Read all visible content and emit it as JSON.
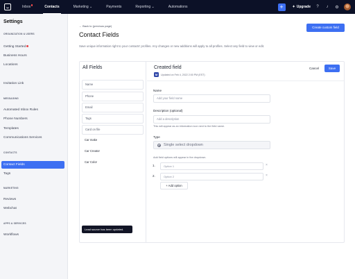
{
  "topnav": {
    "tabs": [
      {
        "label": "Inbox",
        "badge": true
      },
      {
        "label": "Contacts",
        "active": true
      },
      {
        "label": "Marketing ⌄"
      },
      {
        "label": "Payments"
      },
      {
        "label": "Reporting ⌄"
      },
      {
        "label": "Automations"
      }
    ],
    "add_label": "+",
    "upgrade_label": "Upgrade",
    "icons": [
      "upgrade-icon",
      "help-icon",
      "notification-icon",
      "settings-icon"
    ]
  },
  "sidebar": {
    "title": "Settings",
    "sections": {
      "org": "ORGANIZATION & USERS",
      "messaging": "MESSAGING",
      "contacts": "CONTACTS",
      "marketing": "MARKETING",
      "apps": "APPS & SERVICES"
    },
    "items": {
      "getting_started": "Getting Started",
      "business_hours": "Business Hours",
      "locations": "Locations",
      "invitation_link": "Invitation Link",
      "automated_inbox_rules": "Automated Inbox Rules",
      "phone_numbers": "Phone Numbers",
      "templates": "Templates",
      "communications_services": "Communications Services",
      "contact_fields": "Contact Fields",
      "tags": "Tags",
      "reviews": "Reviews",
      "webchat": "Webchat",
      "workflows": "Workflows"
    }
  },
  "main": {
    "back_link": "← Back to (previous page)",
    "title": "Contact Fields",
    "description": "Save unique information right to your contacts' profiles. Any changes or new additions will apply to all profiles. Select any field to view or edit.",
    "create_button": "Create custom field"
  },
  "all_fields": {
    "title": "All Fields",
    "items": [
      "Name",
      "Phone",
      "Email",
      "Tags",
      "Card on file",
      "Car make",
      "Car Creator",
      "Car Color"
    ],
    "toast": "Lead source has been updated."
  },
  "editor": {
    "title": "Created field",
    "meta_badge": "M",
    "meta_text": "Updated on Feb 4, 2022 2:00 PM (EST)",
    "cancel": "Cancel",
    "save": "Save",
    "name_label": "Name",
    "name_placeholder": "Add your field name",
    "desc_label": "Description (optional)",
    "desc_placeholder": "Add a description",
    "desc_help": "This will appear as an information icon next to the field name.",
    "type_label": "Type",
    "type_value": "Single select dropdown",
    "options_help": "Add field options will appear in the dropdown.",
    "options": [
      {
        "num": "1.",
        "value": "Option 1"
      },
      {
        "num": "2.",
        "value": "Option 2"
      }
    ],
    "add_option": "+ Add option"
  }
}
